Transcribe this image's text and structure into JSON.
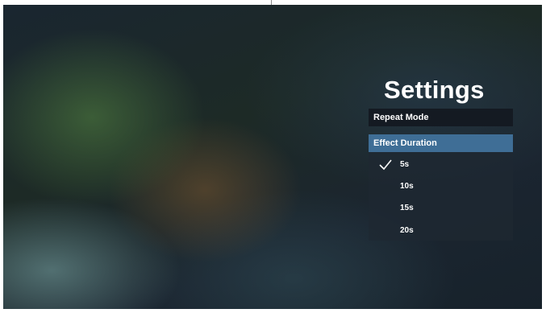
{
  "settings": {
    "title": "Settings",
    "menu": {
      "repeat_mode": "Repeat Mode",
      "effect_duration": "Effect Duration"
    },
    "effect_duration_options": [
      {
        "label": "5s",
        "selected": true
      },
      {
        "label": "10s",
        "selected": false
      },
      {
        "label": "15s",
        "selected": false
      },
      {
        "label": "20s",
        "selected": false
      }
    ]
  },
  "icons": {
    "selected_marker": "check-icon"
  },
  "colors": {
    "highlight": "#3f6e96",
    "menu_item_bg": "#141a22",
    "text": "#ffffff"
  }
}
